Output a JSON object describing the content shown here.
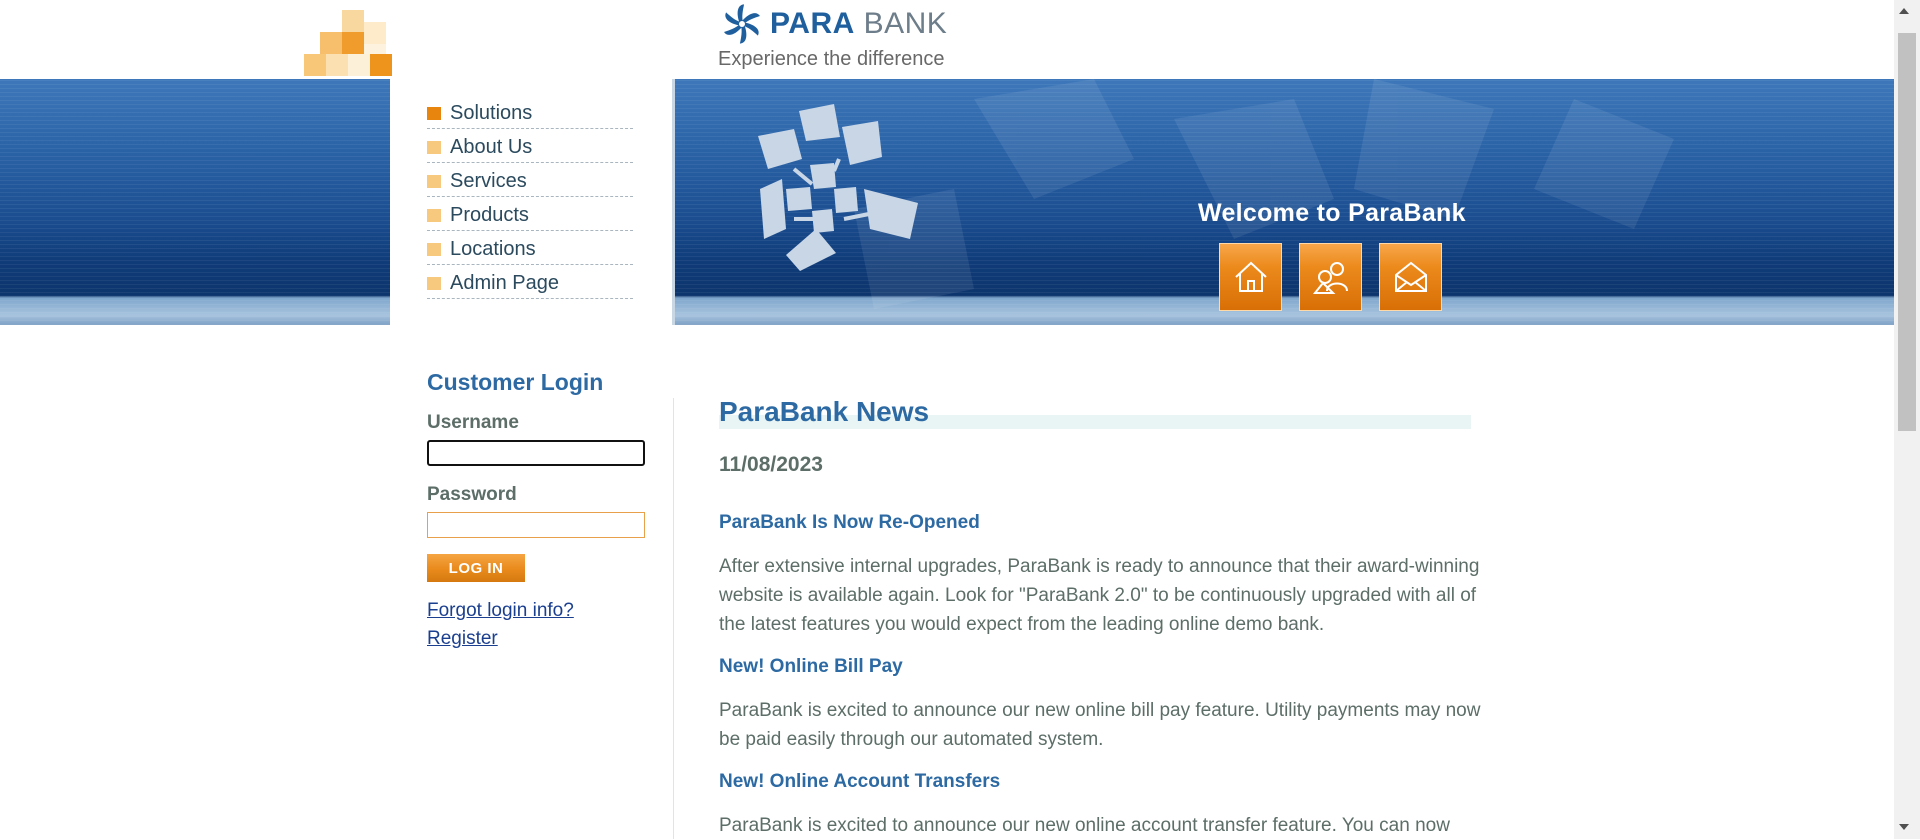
{
  "brand": {
    "name_part1": "PARA",
    "name_part2": "BANK",
    "tagline": "Experience the difference"
  },
  "menu": {
    "items": [
      {
        "label": "Solutions",
        "active": true
      },
      {
        "label": "About Us"
      },
      {
        "label": "Services"
      },
      {
        "label": "Products"
      },
      {
        "label": "Locations"
      },
      {
        "label": "Admin Page"
      }
    ]
  },
  "banner": {
    "welcome": "Welcome to ParaBank",
    "icons": [
      "home-icon",
      "contact-icon",
      "mail-icon"
    ]
  },
  "login": {
    "title": "Customer Login",
    "username_label": "Username",
    "username_value": "",
    "password_label": "Password",
    "password_value": "",
    "button": "LOG IN",
    "forgot": "Forgot login info?",
    "register": "Register"
  },
  "news": {
    "title": "ParaBank News",
    "date": "11/08/2023",
    "items": [
      {
        "heading": "ParaBank Is Now Re-Opened",
        "body": "After extensive internal upgrades, ParaBank is ready to announce that their award-winning website is available again. Look for \"ParaBank 2.0\" to be continuously upgraded with all of the latest features you would expect from the leading online demo bank."
      },
      {
        "heading": "New! Online Bill Pay",
        "body": "ParaBank is excited to announce our new online bill pay feature. Utility payments may now be paid easily through our automated system."
      },
      {
        "heading": "New! Online Account Transfers",
        "body": "ParaBank is excited to announce our new online account transfer feature. You can now"
      }
    ]
  },
  "colors": {
    "accent_orange": "#e8850f",
    "brand_blue": "#2d6aa3",
    "banner_blue": "#1c4f92"
  }
}
